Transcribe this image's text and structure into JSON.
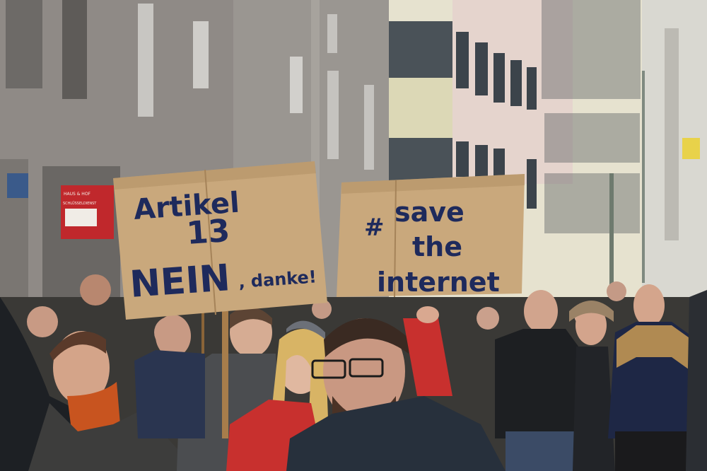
{
  "sign_left": {
    "line1": "Artikel",
    "line2": "13",
    "line3_big": "NEIN",
    "line3_small": ", danke!"
  },
  "sign_right": {
    "hash": "#",
    "line1": "save",
    "line2": "the",
    "line3": "internet"
  },
  "shop_sign": {
    "brand": "SCHLÜSSELDIENST",
    "top_text": "HAUS & HOF"
  },
  "colors": {
    "cardboard": "#c9a87c",
    "cardboard_shadow": "#b08e62",
    "marker_ink": "#1e2a5c",
    "building_left": "#8f8a86",
    "building_right": "#e6e2cf",
    "sky": "#d8d8d4"
  }
}
